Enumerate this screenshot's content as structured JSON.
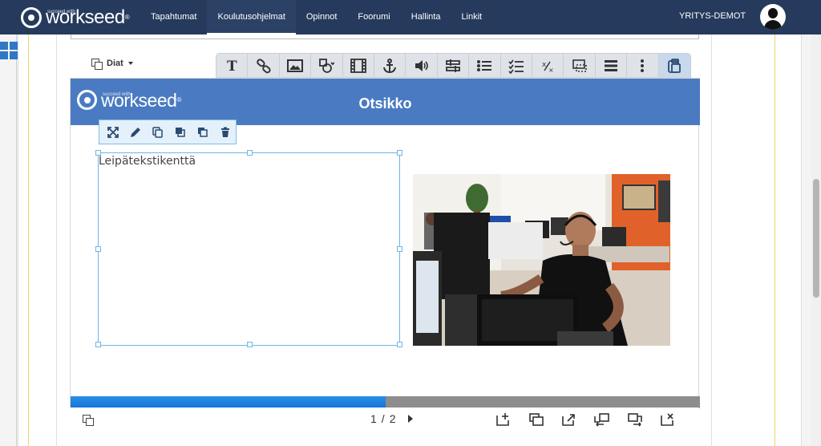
{
  "nav": {
    "logo_text": "workseed",
    "logo_sub": "succeed with",
    "logo_reg": "®",
    "items": [
      {
        "label": "Tapahtumat"
      },
      {
        "label": "Koulutusohjelmat"
      },
      {
        "label": "Opinnot"
      },
      {
        "label": "Foorumi"
      },
      {
        "label": "Hallinta"
      },
      {
        "label": "Linkit"
      }
    ],
    "active_item": "Koulutusohjelmat",
    "company": "YRITYS-DEMOT"
  },
  "editor": {
    "slides_label": "Diat",
    "toolbar_icons": [
      "text-icon",
      "link-icon",
      "image-icon",
      "shapes-icon",
      "video-icon",
      "anchor-icon",
      "audio-icon",
      "slider-icon",
      "list-icon",
      "checklist-icon",
      "fraction-icon",
      "selection-icon",
      "rows-icon",
      "more-icon",
      "clipboard-icon"
    ]
  },
  "slide": {
    "title": "Otsikko",
    "logo_text": "workseed",
    "logo_sub": "succeed with",
    "logo_reg": "®",
    "body_text": "Leipätekstikenttä",
    "element_tools": [
      "expand-icon",
      "edit-icon",
      "duplicate-icon",
      "bring-front-icon",
      "send-back-icon",
      "delete-icon"
    ],
    "image_alt": "photo-man-with-headset-at-desk",
    "progress_fraction": 0.5
  },
  "pager": {
    "current": "1",
    "separator": "/",
    "total": "2"
  },
  "bottom_actions": [
    "add-slide-icon",
    "copy-slide-icon",
    "export-slide-icon",
    "move-slide-left-icon",
    "move-slide-right-icon",
    "delete-slide-icon"
  ],
  "colors": {
    "nav_bg": "#253a5c",
    "slide_header": "#4a7bc2",
    "progress_fill": "#1173d8",
    "progress_track": "#8d8d8d"
  }
}
